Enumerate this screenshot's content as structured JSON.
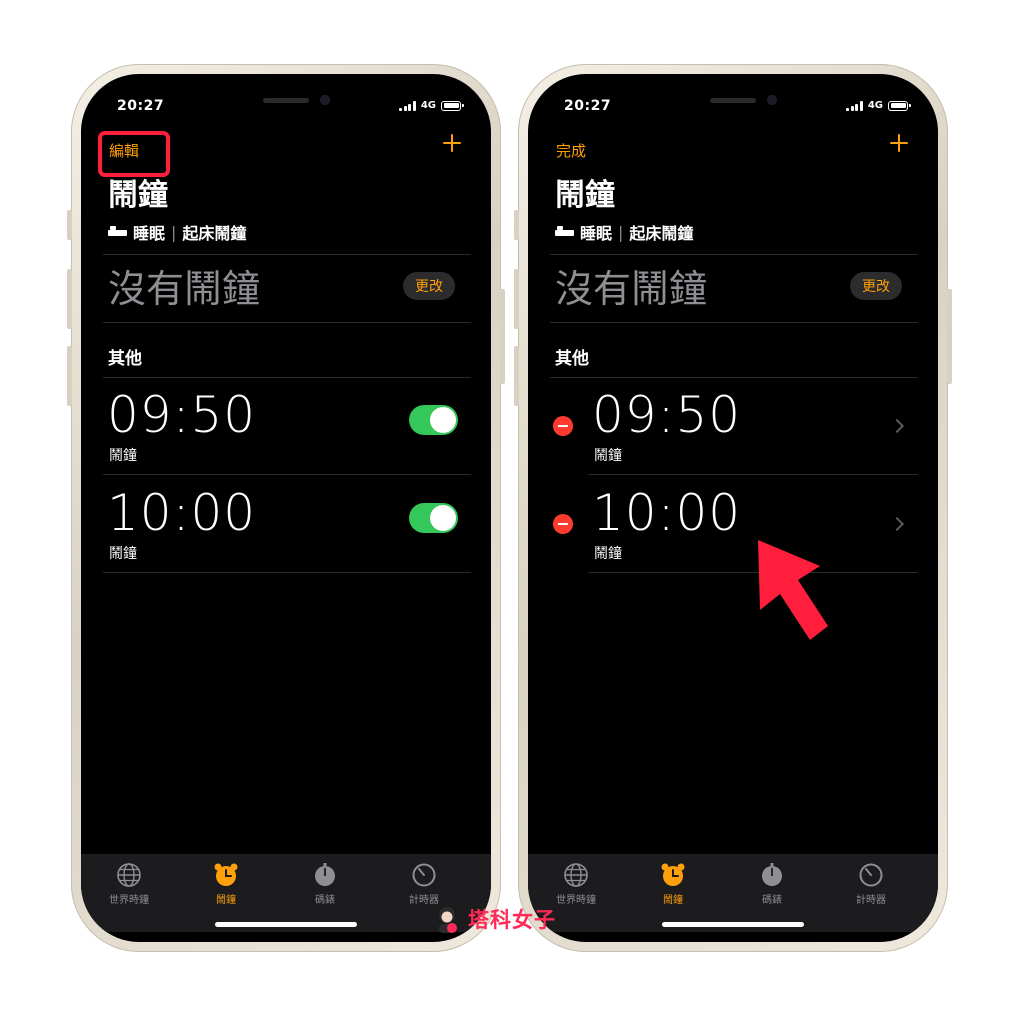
{
  "status": {
    "time": "20:27",
    "network": "4G"
  },
  "left": {
    "nav_left": "編輯",
    "title": "鬧鐘",
    "sleep_label": "睡眠",
    "wake_label": "起床鬧鐘",
    "no_alarm": "沒有鬧鐘",
    "change_button": "更改",
    "section": "其他",
    "alarms": [
      {
        "time": "09:50",
        "label": "鬧鐘",
        "enabled": true
      },
      {
        "time": "10:00",
        "label": "鬧鐘",
        "enabled": true
      }
    ]
  },
  "right": {
    "nav_left": "完成",
    "title": "鬧鐘",
    "sleep_label": "睡眠",
    "wake_label": "起床鬧鐘",
    "no_alarm": "沒有鬧鐘",
    "change_button": "更改",
    "section": "其他",
    "alarms": [
      {
        "time": "09:50",
        "label": "鬧鐘"
      },
      {
        "time": "10:00",
        "label": "鬧鐘"
      }
    ]
  },
  "tabs": [
    {
      "label": "世界時鐘",
      "icon": "globe-icon"
    },
    {
      "label": "鬧鐘",
      "icon": "alarm-clock-icon",
      "active": true
    },
    {
      "label": "碼錶",
      "icon": "stopwatch-icon"
    },
    {
      "label": "計時器",
      "icon": "timer-icon"
    }
  ],
  "colors": {
    "accent": "#ff9f0a",
    "toggle_on": "#34c759",
    "delete": "#ff3b30",
    "highlight": "#ff1f3d"
  },
  "watermark": {
    "text": "塔科女子",
    "badge": "3C"
  }
}
